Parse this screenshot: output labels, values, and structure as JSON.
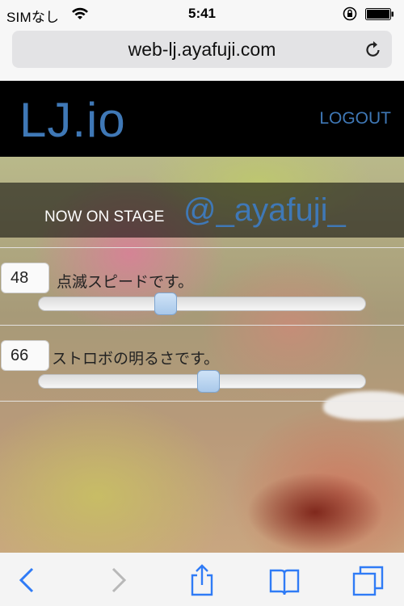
{
  "status_bar": {
    "carrier": "SIMなし",
    "time": "5:41"
  },
  "address_bar": {
    "url": "web-lj.ayafuji.com"
  },
  "site": {
    "logo": "LJ.io",
    "logout_label": "LOGOUT"
  },
  "stage": {
    "label": "NOW ON STAGE",
    "user": "@_ayafuji_"
  },
  "controls": [
    {
      "value": "48",
      "label": "点滅スピードです。",
      "slider_fraction": 0.38
    },
    {
      "value": "66",
      "label": "ストロボの明るさです。",
      "slider_fraction": 0.52
    }
  ],
  "colors": {
    "accent": "#3f78b6",
    "toolbar_icon": "#2f7bf6"
  },
  "toolbar": {
    "icons": [
      "back-icon",
      "forward-icon",
      "share-icon",
      "bookmarks-icon",
      "tabs-icon"
    ]
  }
}
